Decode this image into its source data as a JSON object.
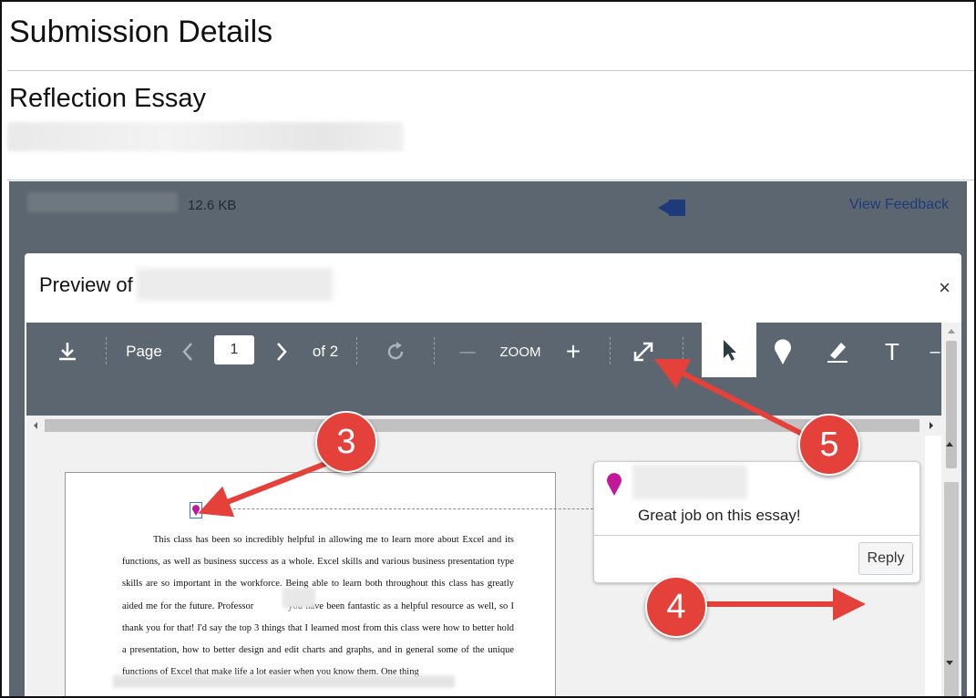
{
  "page": {
    "title": "Submission Details",
    "essay_title": "Reflection Essay"
  },
  "file_bar": {
    "size": "12.6 KB",
    "view_feedback": "View Feedback"
  },
  "preview": {
    "title": "Preview of",
    "close": "×"
  },
  "toolbar": {
    "page_label": "Page",
    "page_value": "1",
    "page_total": "of 2",
    "zoom_label": "ZOOM",
    "minus": "—",
    "plus": "+",
    "text_tool": "T"
  },
  "document": {
    "paragraph": "This class has been so incredibly helpful in allowing me to learn more about Excel and its functions, as well as business success as a whole. Excel skills and various business presentation type skills are so important in the workforce. Being able to learn both throughout this class has greatly aided me for the future. Professor",
    "paragraph_cont": "you have been fantastic as a helpful resource as well, so I thank you for that! I'd say the top 3 things that I learned most from this class were how to better hold a presentation, how to better design and edit charts and graphs, and in general some of the unique functions of Excel that make life a lot easier when you know them. One thing"
  },
  "comment": {
    "text": "Great job on this essay!",
    "reply": "Reply"
  },
  "annotations": {
    "badge_3": "3",
    "badge_4": "4",
    "badge_5": "5"
  },
  "colors": {
    "overlay": "#5c6670",
    "pin": "#c1189b",
    "badge": "#e4413a",
    "link": "#203a7a"
  }
}
